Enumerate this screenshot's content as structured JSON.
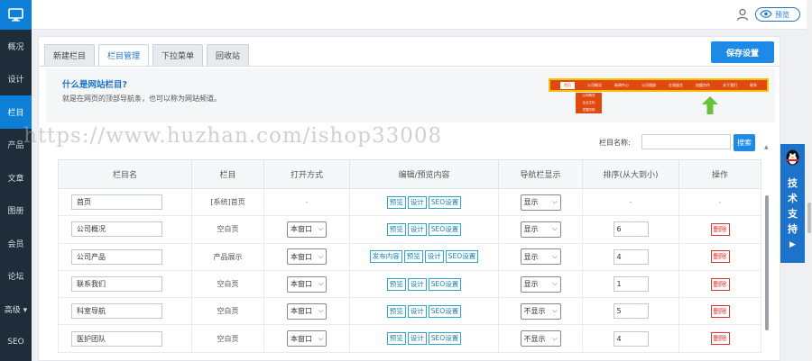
{
  "sidebar": {
    "items": [
      {
        "label": "概况"
      },
      {
        "label": "设计"
      },
      {
        "label": "栏目",
        "active": true
      },
      {
        "label": "产品"
      },
      {
        "label": "文章"
      },
      {
        "label": "图册"
      },
      {
        "label": "会员"
      },
      {
        "label": "论坛"
      },
      {
        "label": "高级 ▾"
      },
      {
        "label": "SEO"
      }
    ]
  },
  "topbar": {
    "preview_label": "预览"
  },
  "tabs": [
    {
      "label": "新建栏目",
      "active": false
    },
    {
      "label": "栏目管理",
      "active": true
    },
    {
      "label": "下拉菜单",
      "active": false
    },
    {
      "label": "回收站",
      "active": false
    }
  ],
  "toolbar": {
    "save_label": "保存设置"
  },
  "info": {
    "title": "什么是网站栏目?",
    "desc": "就是在网页的顶部导航条，也可以称为网站频道。",
    "demo_nav": [
      "首页",
      "公司概况",
      "新闻中心",
      "公司相册",
      "在线留言",
      "加盟合作",
      "关于我们",
      "联系"
    ],
    "demo_sub": [
      "公司概况",
      "企业文化",
      "发展历程"
    ]
  },
  "search": {
    "label": "栏目名称:",
    "button": "搜索"
  },
  "table": {
    "headers": [
      "栏目名",
      "栏目",
      "打开方式",
      "编辑/预览内容",
      "导航栏显示",
      "排序(从大到小)",
      "操作"
    ],
    "rows": [
      {
        "name": "首页",
        "type": "[系统]首页",
        "open": "-",
        "actions": [
          "预览",
          "设计",
          "SEO设置"
        ],
        "nav": "显示",
        "order": "-",
        "op": "-"
      },
      {
        "name": "公司概况",
        "type": "空白页",
        "open": "本窗口",
        "actions": [
          "预览",
          "设计",
          "SEO设置"
        ],
        "nav": "显示",
        "order": "6",
        "op": "删除"
      },
      {
        "name": "公司产品",
        "type": "产品展示",
        "open": "本窗口",
        "actions": [
          "发布内容",
          "预览",
          "设计",
          "SEO设置"
        ],
        "nav": "显示",
        "order": "4",
        "op": "删除"
      },
      {
        "name": "联系我们",
        "type": "空白页",
        "open": "本窗口",
        "actions": [
          "预览",
          "设计",
          "SEO设置"
        ],
        "nav": "显示",
        "order": "1",
        "op": "删除"
      },
      {
        "name": "科室导航",
        "type": "空白页",
        "open": "本窗口",
        "actions": [
          "预览",
          "设计",
          "SEO设置"
        ],
        "nav": "不显示",
        "order": "5",
        "op": "删除"
      },
      {
        "name": "医护团队",
        "type": "空白页",
        "open": "本窗口",
        "actions": [
          "预览",
          "设计",
          "SEO设置"
        ],
        "nav": "不显示",
        "order": "4",
        "op": "删除"
      }
    ]
  },
  "support": {
    "label": "技术支持"
  },
  "watermark": "https://www.huzhan.com/ishop33008",
  "colors": {
    "sidebar_bg": "#1f2d3a",
    "accent": "#0e7fd6",
    "danger": "#dd3333",
    "demo_nav": "#e04a10"
  }
}
